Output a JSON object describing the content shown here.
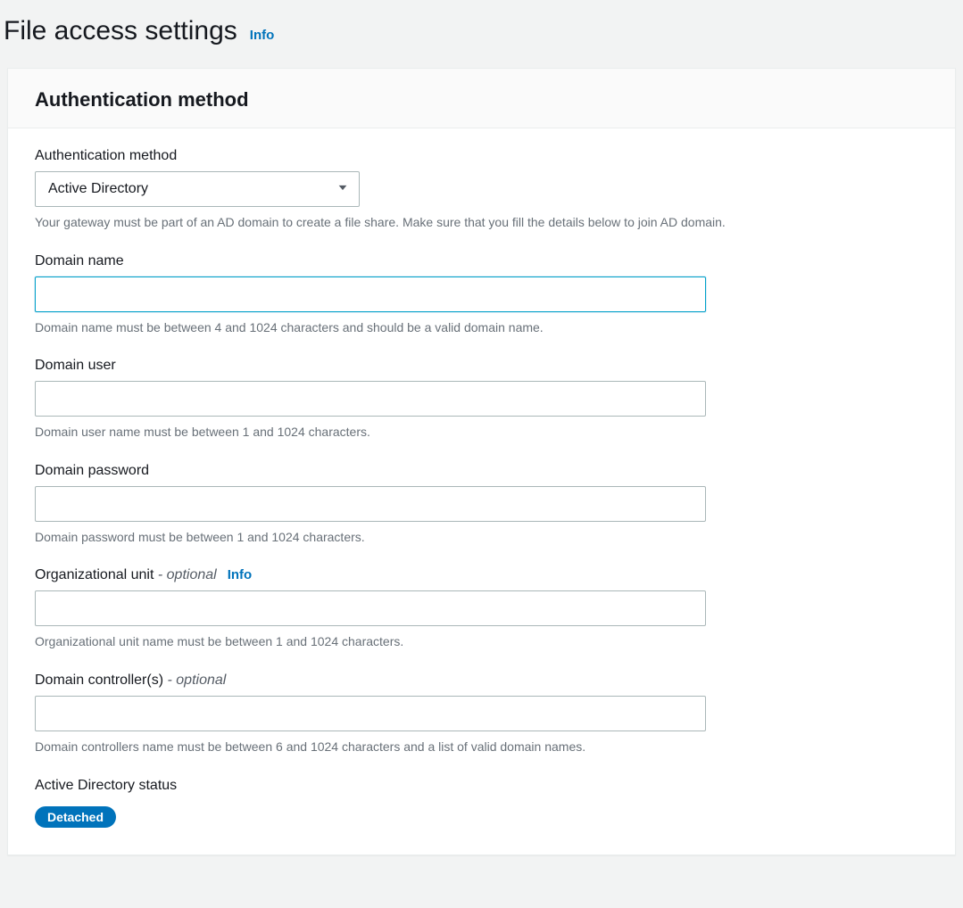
{
  "header": {
    "title": "File access settings",
    "info_link": "Info"
  },
  "panel": {
    "title": "Authentication method"
  },
  "fields": {
    "auth_method": {
      "label": "Authentication method",
      "value": "Active Directory",
      "help": "Your gateway must be part of an AD domain to create a file share. Make sure that you fill the details below to join AD domain."
    },
    "domain_name": {
      "label": "Domain name",
      "value": "",
      "help": "Domain name must be between 4 and 1024 characters and should be a valid domain name."
    },
    "domain_user": {
      "label": "Domain user",
      "value": "",
      "help": "Domain user name must be between 1 and 1024 characters."
    },
    "domain_password": {
      "label": "Domain password",
      "value": "",
      "help": "Domain password must be between 1 and 1024 characters."
    },
    "org_unit": {
      "label": "Organizational unit",
      "optional": "- optional",
      "info_link": "Info",
      "value": "",
      "help": "Organizational unit name must be between 1 and 1024 characters."
    },
    "domain_controllers": {
      "label": "Domain controller(s)",
      "optional": "- optional",
      "value": "",
      "help": "Domain controllers name must be between 6 and 1024 characters and a list of valid domain names."
    },
    "ad_status": {
      "label": "Active Directory status",
      "badge": "Detached"
    }
  }
}
